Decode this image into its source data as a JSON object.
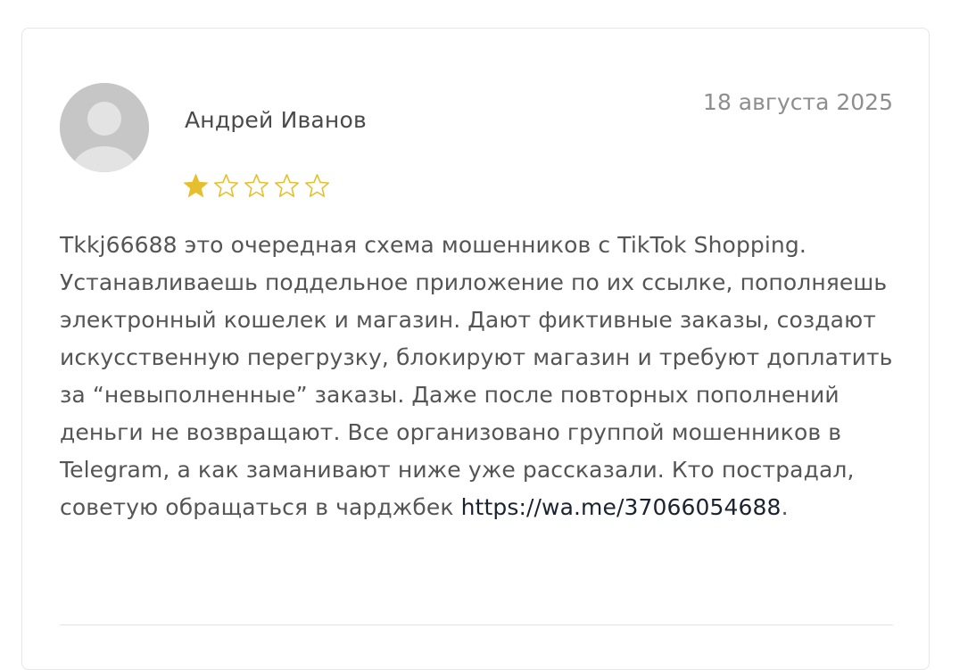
{
  "review": {
    "author": "Андрей Иванов",
    "date": "18 августа 2025",
    "rating": {
      "value": 1,
      "max": 5
    },
    "text": "Tkkj66688 это очередная схема мошенников с TikTok Shopping. Устанавливаешь поддельное приложение по их ссылке, пополняешь электронный кошелек и магазин. Дают фиктивные заказы, создают искусственную перегрузку, блокируют магазин и требуют доплатить за “невыполненные” заказы. Даже после повторных пополнений деньги не возвращают. Все организовано группой мошенников в Telegram, а как заманивают ниже уже рассказали. Кто пострадал, советую обращаться в чарджбек ",
    "link_text": "https://wa.me/37066054688",
    "text_end": "."
  },
  "icons": {
    "avatar": "default-user-avatar-icon",
    "star_filled": "star-filled-icon",
    "star_empty": "star-outline-icon"
  },
  "colors": {
    "star": "#e6bf2e",
    "author_text": "#4a4a4a",
    "date_text": "#8e8e8e",
    "body_text": "#555555",
    "link_text": "#1c2330",
    "avatar_bg": "#c6c6c6"
  }
}
